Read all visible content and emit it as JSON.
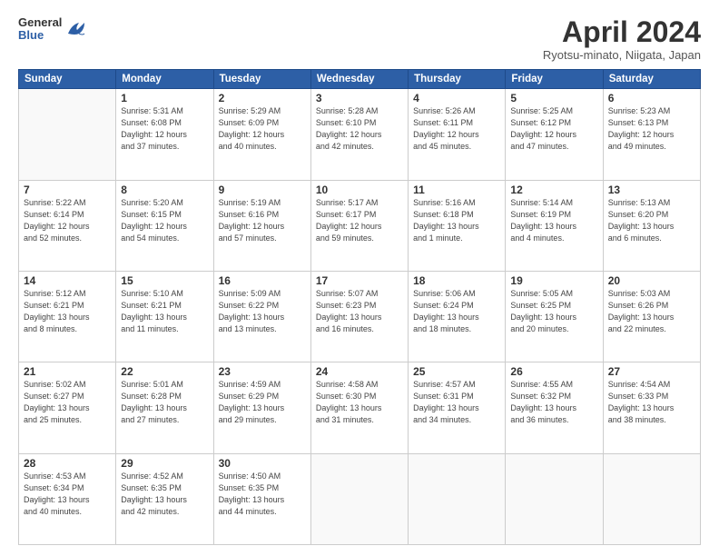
{
  "header": {
    "logo_line1": "General",
    "logo_line2": "Blue",
    "title": "April 2024",
    "subtitle": "Ryotsu-minato, Niigata, Japan"
  },
  "weekdays": [
    "Sunday",
    "Monday",
    "Tuesday",
    "Wednesday",
    "Thursday",
    "Friday",
    "Saturday"
  ],
  "weeks": [
    [
      {
        "day": "",
        "info": ""
      },
      {
        "day": "1",
        "info": "Sunrise: 5:31 AM\nSunset: 6:08 PM\nDaylight: 12 hours\nand 37 minutes."
      },
      {
        "day": "2",
        "info": "Sunrise: 5:29 AM\nSunset: 6:09 PM\nDaylight: 12 hours\nand 40 minutes."
      },
      {
        "day": "3",
        "info": "Sunrise: 5:28 AM\nSunset: 6:10 PM\nDaylight: 12 hours\nand 42 minutes."
      },
      {
        "day": "4",
        "info": "Sunrise: 5:26 AM\nSunset: 6:11 PM\nDaylight: 12 hours\nand 45 minutes."
      },
      {
        "day": "5",
        "info": "Sunrise: 5:25 AM\nSunset: 6:12 PM\nDaylight: 12 hours\nand 47 minutes."
      },
      {
        "day": "6",
        "info": "Sunrise: 5:23 AM\nSunset: 6:13 PM\nDaylight: 12 hours\nand 49 minutes."
      }
    ],
    [
      {
        "day": "7",
        "info": "Sunrise: 5:22 AM\nSunset: 6:14 PM\nDaylight: 12 hours\nand 52 minutes."
      },
      {
        "day": "8",
        "info": "Sunrise: 5:20 AM\nSunset: 6:15 PM\nDaylight: 12 hours\nand 54 minutes."
      },
      {
        "day": "9",
        "info": "Sunrise: 5:19 AM\nSunset: 6:16 PM\nDaylight: 12 hours\nand 57 minutes."
      },
      {
        "day": "10",
        "info": "Sunrise: 5:17 AM\nSunset: 6:17 PM\nDaylight: 12 hours\nand 59 minutes."
      },
      {
        "day": "11",
        "info": "Sunrise: 5:16 AM\nSunset: 6:18 PM\nDaylight: 13 hours\nand 1 minute."
      },
      {
        "day": "12",
        "info": "Sunrise: 5:14 AM\nSunset: 6:19 PM\nDaylight: 13 hours\nand 4 minutes."
      },
      {
        "day": "13",
        "info": "Sunrise: 5:13 AM\nSunset: 6:20 PM\nDaylight: 13 hours\nand 6 minutes."
      }
    ],
    [
      {
        "day": "14",
        "info": "Sunrise: 5:12 AM\nSunset: 6:21 PM\nDaylight: 13 hours\nand 8 minutes."
      },
      {
        "day": "15",
        "info": "Sunrise: 5:10 AM\nSunset: 6:21 PM\nDaylight: 13 hours\nand 11 minutes."
      },
      {
        "day": "16",
        "info": "Sunrise: 5:09 AM\nSunset: 6:22 PM\nDaylight: 13 hours\nand 13 minutes."
      },
      {
        "day": "17",
        "info": "Sunrise: 5:07 AM\nSunset: 6:23 PM\nDaylight: 13 hours\nand 16 minutes."
      },
      {
        "day": "18",
        "info": "Sunrise: 5:06 AM\nSunset: 6:24 PM\nDaylight: 13 hours\nand 18 minutes."
      },
      {
        "day": "19",
        "info": "Sunrise: 5:05 AM\nSunset: 6:25 PM\nDaylight: 13 hours\nand 20 minutes."
      },
      {
        "day": "20",
        "info": "Sunrise: 5:03 AM\nSunset: 6:26 PM\nDaylight: 13 hours\nand 22 minutes."
      }
    ],
    [
      {
        "day": "21",
        "info": "Sunrise: 5:02 AM\nSunset: 6:27 PM\nDaylight: 13 hours\nand 25 minutes."
      },
      {
        "day": "22",
        "info": "Sunrise: 5:01 AM\nSunset: 6:28 PM\nDaylight: 13 hours\nand 27 minutes."
      },
      {
        "day": "23",
        "info": "Sunrise: 4:59 AM\nSunset: 6:29 PM\nDaylight: 13 hours\nand 29 minutes."
      },
      {
        "day": "24",
        "info": "Sunrise: 4:58 AM\nSunset: 6:30 PM\nDaylight: 13 hours\nand 31 minutes."
      },
      {
        "day": "25",
        "info": "Sunrise: 4:57 AM\nSunset: 6:31 PM\nDaylight: 13 hours\nand 34 minutes."
      },
      {
        "day": "26",
        "info": "Sunrise: 4:55 AM\nSunset: 6:32 PM\nDaylight: 13 hours\nand 36 minutes."
      },
      {
        "day": "27",
        "info": "Sunrise: 4:54 AM\nSunset: 6:33 PM\nDaylight: 13 hours\nand 38 minutes."
      }
    ],
    [
      {
        "day": "28",
        "info": "Sunrise: 4:53 AM\nSunset: 6:34 PM\nDaylight: 13 hours\nand 40 minutes."
      },
      {
        "day": "29",
        "info": "Sunrise: 4:52 AM\nSunset: 6:35 PM\nDaylight: 13 hours\nand 42 minutes."
      },
      {
        "day": "30",
        "info": "Sunrise: 4:50 AM\nSunset: 6:35 PM\nDaylight: 13 hours\nand 44 minutes."
      },
      {
        "day": "",
        "info": ""
      },
      {
        "day": "",
        "info": ""
      },
      {
        "day": "",
        "info": ""
      },
      {
        "day": "",
        "info": ""
      }
    ]
  ]
}
